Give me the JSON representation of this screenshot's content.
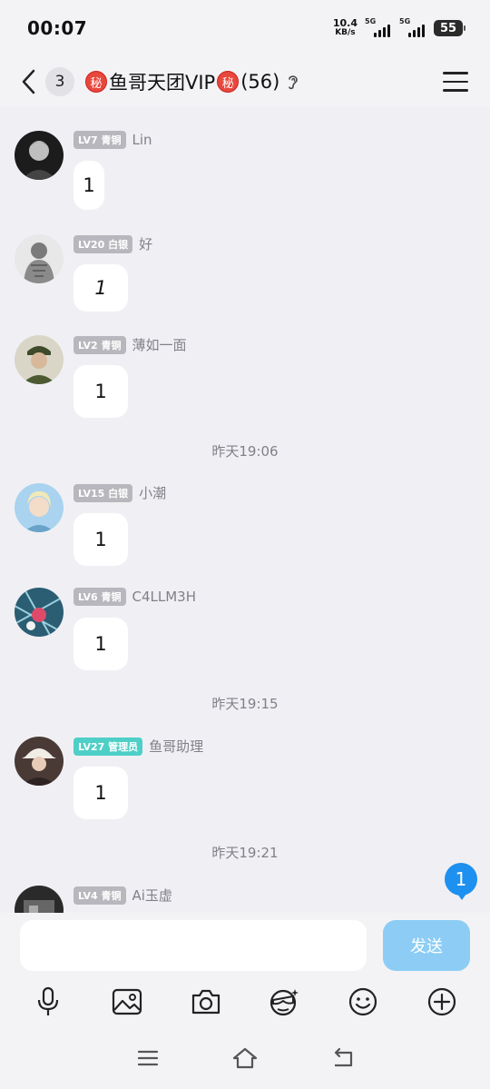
{
  "status": {
    "time": "00:07",
    "net_speed_value": "10.4",
    "net_speed_unit": "KB/s",
    "sim1": "5G",
    "sim2": "5G",
    "battery": "55"
  },
  "header": {
    "unread": "3",
    "secret_badge": "秘",
    "group_name": "鱼哥天团VIP",
    "member_count": "(56)"
  },
  "messages": [
    {
      "level": "LV7 青铜",
      "nick": "Lin",
      "text": "1",
      "badge_type": "normal"
    },
    {
      "level": "LV20 白银",
      "nick": "好",
      "text": "1",
      "badge_type": "normal"
    },
    {
      "level": "LV2 青铜",
      "nick": "薄如一面",
      "text": "1",
      "badge_type": "normal"
    },
    {
      "level": "LV15 白银",
      "nick": "小潮",
      "text": "1",
      "badge_type": "normal"
    },
    {
      "level": "LV6 青铜",
      "nick": "C4LLM3H",
      "text": "1",
      "badge_type": "normal"
    },
    {
      "level": "LV27 管理员",
      "nick": "鱼哥助理",
      "text": "1",
      "badge_type": "admin"
    },
    {
      "level": "LV4 青铜",
      "nick": "Ai玉虚",
      "text": "",
      "badge_type": "normal"
    }
  ],
  "timestamps": [
    "昨天19:06",
    "昨天19:15",
    "昨天19:21"
  ],
  "new_message_count": "1",
  "input": {
    "placeholder": "",
    "send_label": "发送"
  },
  "toolbar_icons": [
    "microphone-icon",
    "image-icon",
    "camera-icon",
    "sticker-icon",
    "emoji-icon",
    "plus-icon"
  ],
  "colors": {
    "accent": "#1e90f0",
    "send_button": "#8dcdf5",
    "admin_badge": "#4ecfc7",
    "level_badge": "#b7b7bd",
    "secret_badge": "#e8473c"
  }
}
